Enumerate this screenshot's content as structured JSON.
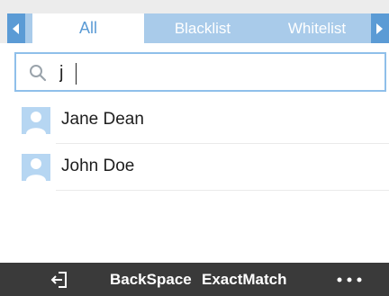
{
  "tabs": [
    {
      "label": "All",
      "active": true
    },
    {
      "label": "Blacklist",
      "active": false
    },
    {
      "label": "Whitelist",
      "active": false
    }
  ],
  "search": {
    "value": "j",
    "icon": "search-icon"
  },
  "contacts": [
    {
      "name": "Jane Dean"
    },
    {
      "name": "John Doe"
    }
  ],
  "softkeys": {
    "back_icon": "exit-icon",
    "backspace_label": "BackSpace",
    "exactmatch_label": "ExactMatch",
    "more_icon": "more-dots-icon"
  },
  "colors": {
    "accent": "#5b9bd5",
    "tab_inactive_bg": "#a9cbea",
    "softbar_bg": "#3a3a3a",
    "avatar_bg": "#b6d6f2"
  }
}
